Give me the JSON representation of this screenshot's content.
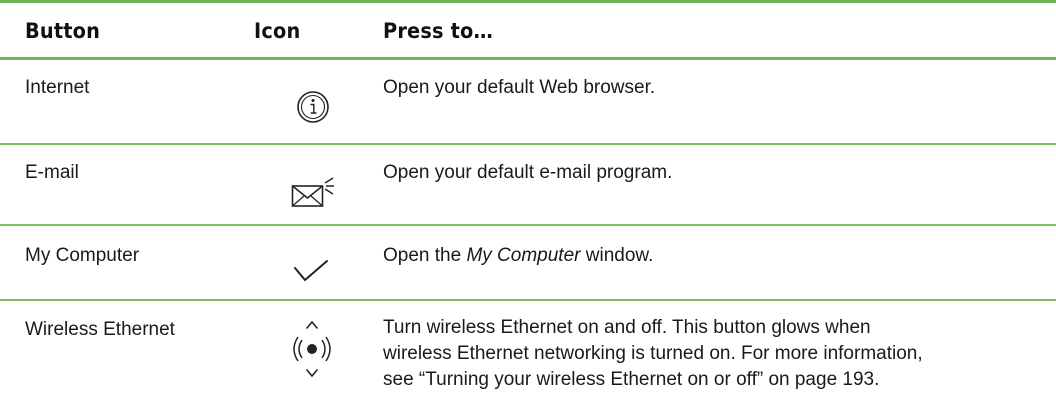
{
  "header": {
    "button": "Button",
    "icon": "Icon",
    "press_to": "Press to…"
  },
  "rows": [
    {
      "button": "Internet",
      "icon": "info-circle-icon",
      "description": "Open your default Web browser."
    },
    {
      "button": "E-mail",
      "icon": "envelope-icon",
      "description": "Open your default e-mail program."
    },
    {
      "button": "My Computer",
      "icon": "checkmark-icon",
      "desc_prefix": "Open the ",
      "desc_italic": "My Computer",
      "desc_suffix": " window."
    },
    {
      "button": "Wireless Ethernet",
      "icon": "wireless-signal-icon",
      "desc_lines": [
        "Turn wireless Ethernet on and off. This button glows when",
        "wireless Ethernet networking is turned on. For more information,",
        "see “Turning your wireless Ethernet on or off” on page 193."
      ]
    }
  ],
  "colors": {
    "rule": "#6fb454",
    "text": "#1a1a1a"
  }
}
